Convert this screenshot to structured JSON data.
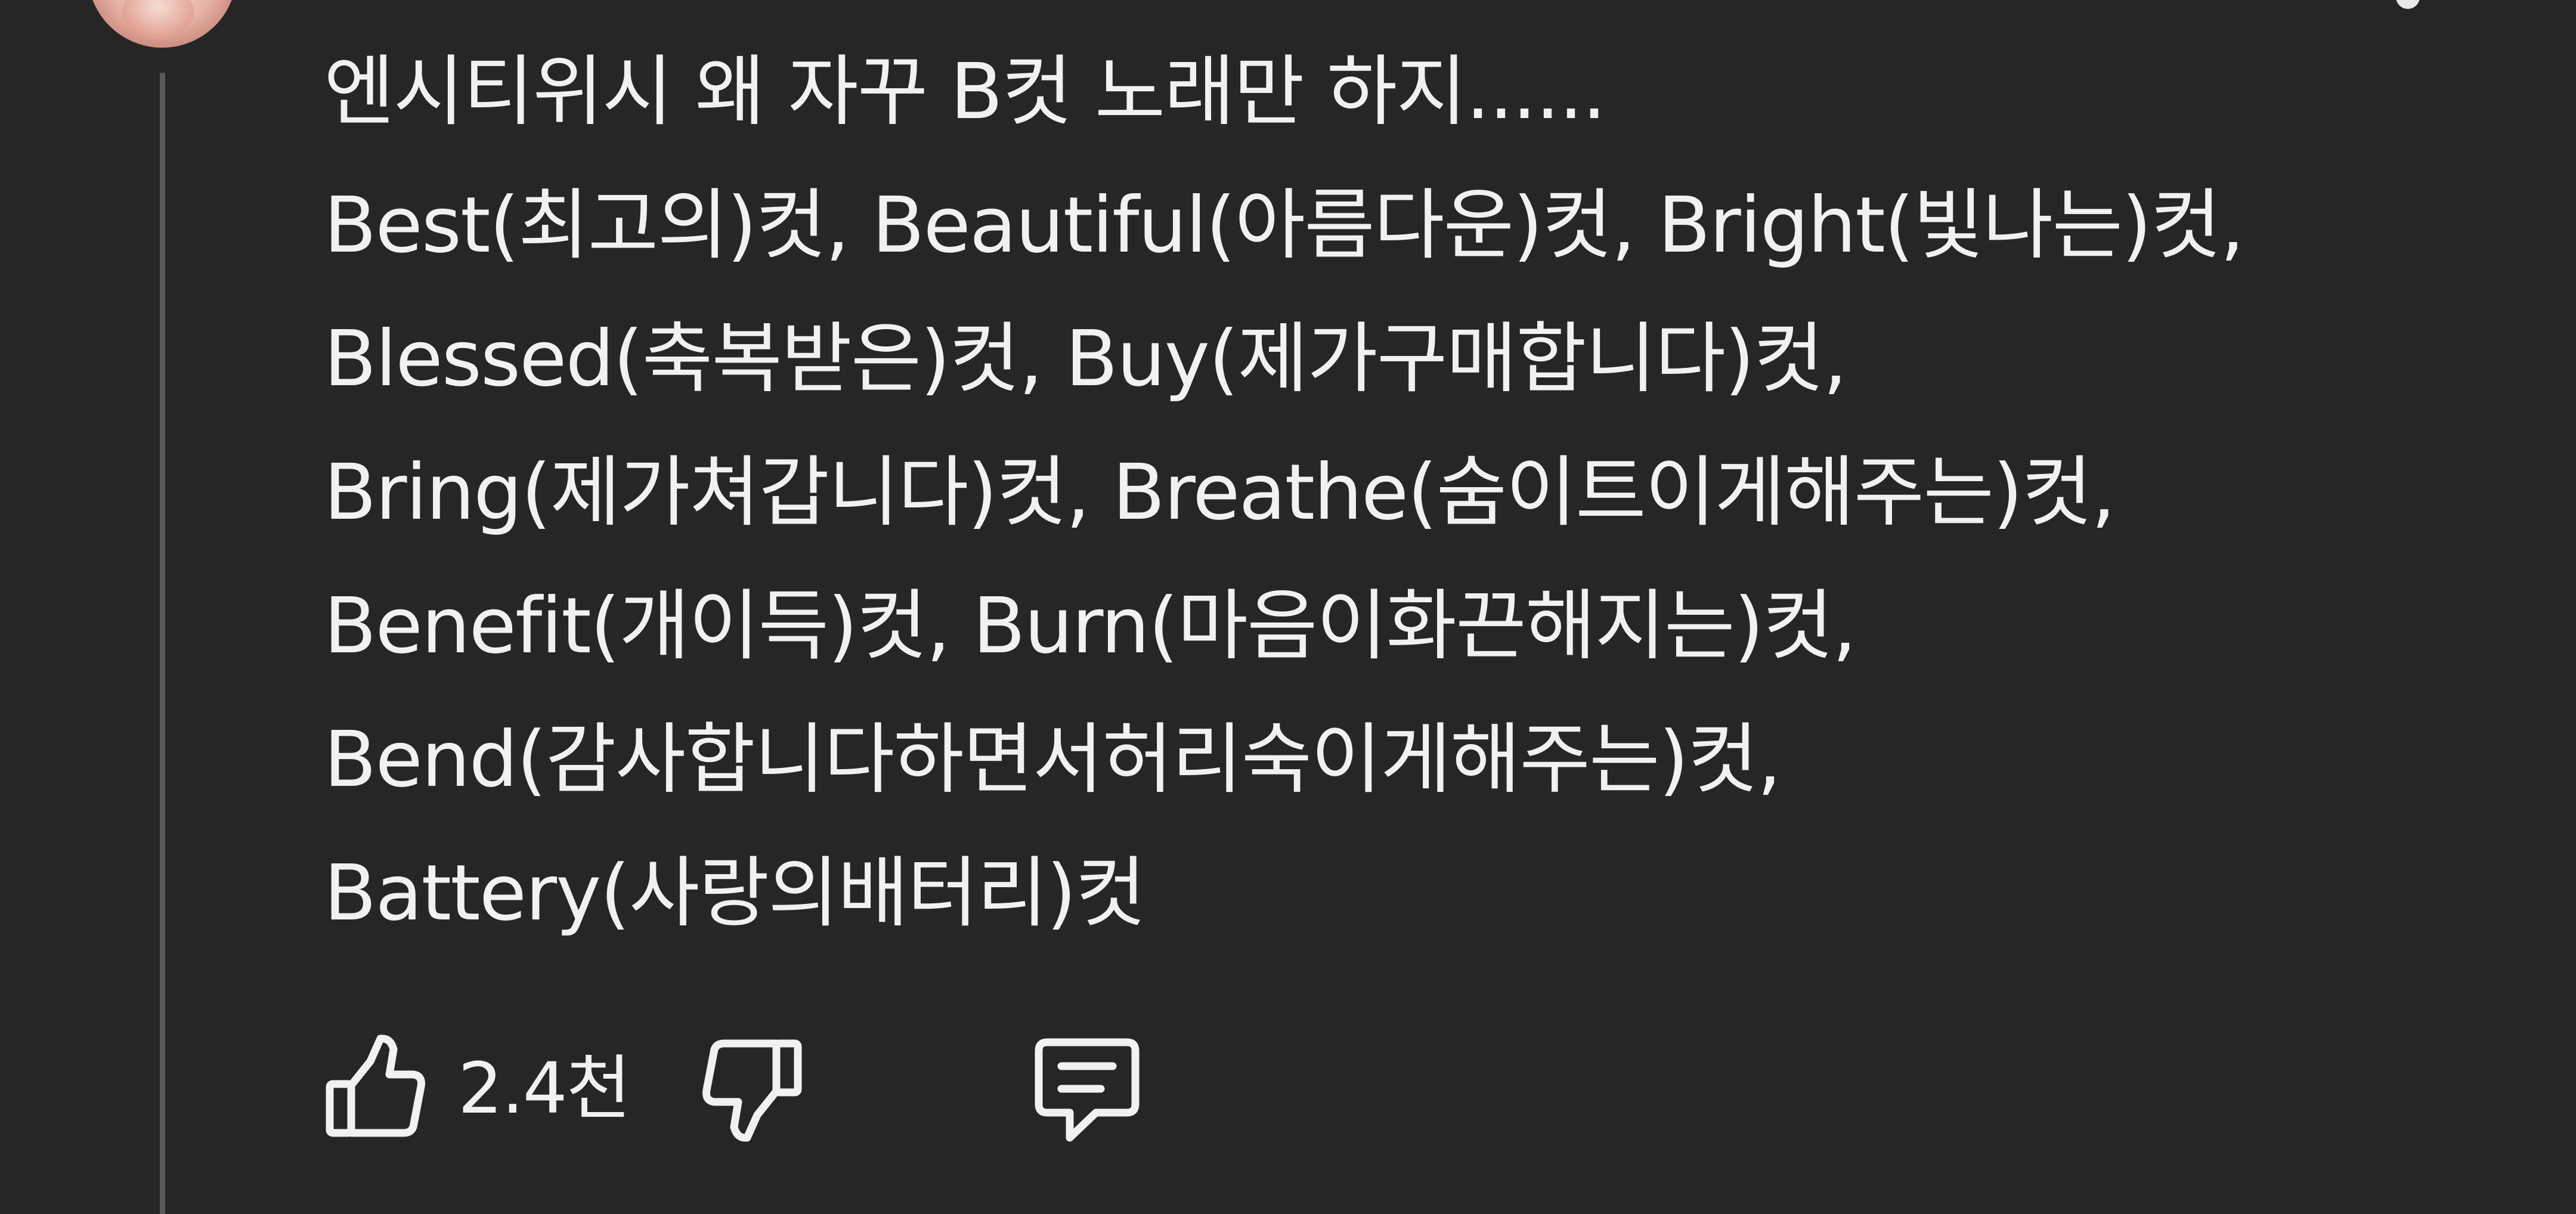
{
  "comment": {
    "lines": [
      "엔시티위시 왜 자꾸 B컷 노래만 하지......",
      "Best(최고의)컷, Beautiful(아름다운)컷, Bright(빛나는)컷,",
      "Blessed(축복받은)컷, Buy(제가구매합니다)컷,",
      "Bring(제가쳐갑니다)컷, Breathe(숨이트이게해주는)컷,",
      "Benefit(개이득)컷, Burn(마음이화끈해지는)컷,",
      "Bend(감사합니다하면서허리숙이게해주는)컷,",
      "Battery(사랑의배터리)컷"
    ]
  },
  "actions": {
    "like_count": "2.4천",
    "like_icon": "thumbs-up-icon",
    "dislike_icon": "thumbs-down-icon",
    "reply_icon": "comment-icon"
  },
  "colors": {
    "background": "#262626",
    "text": "#f1f1f1",
    "thread_line": "#5a5a5a"
  }
}
